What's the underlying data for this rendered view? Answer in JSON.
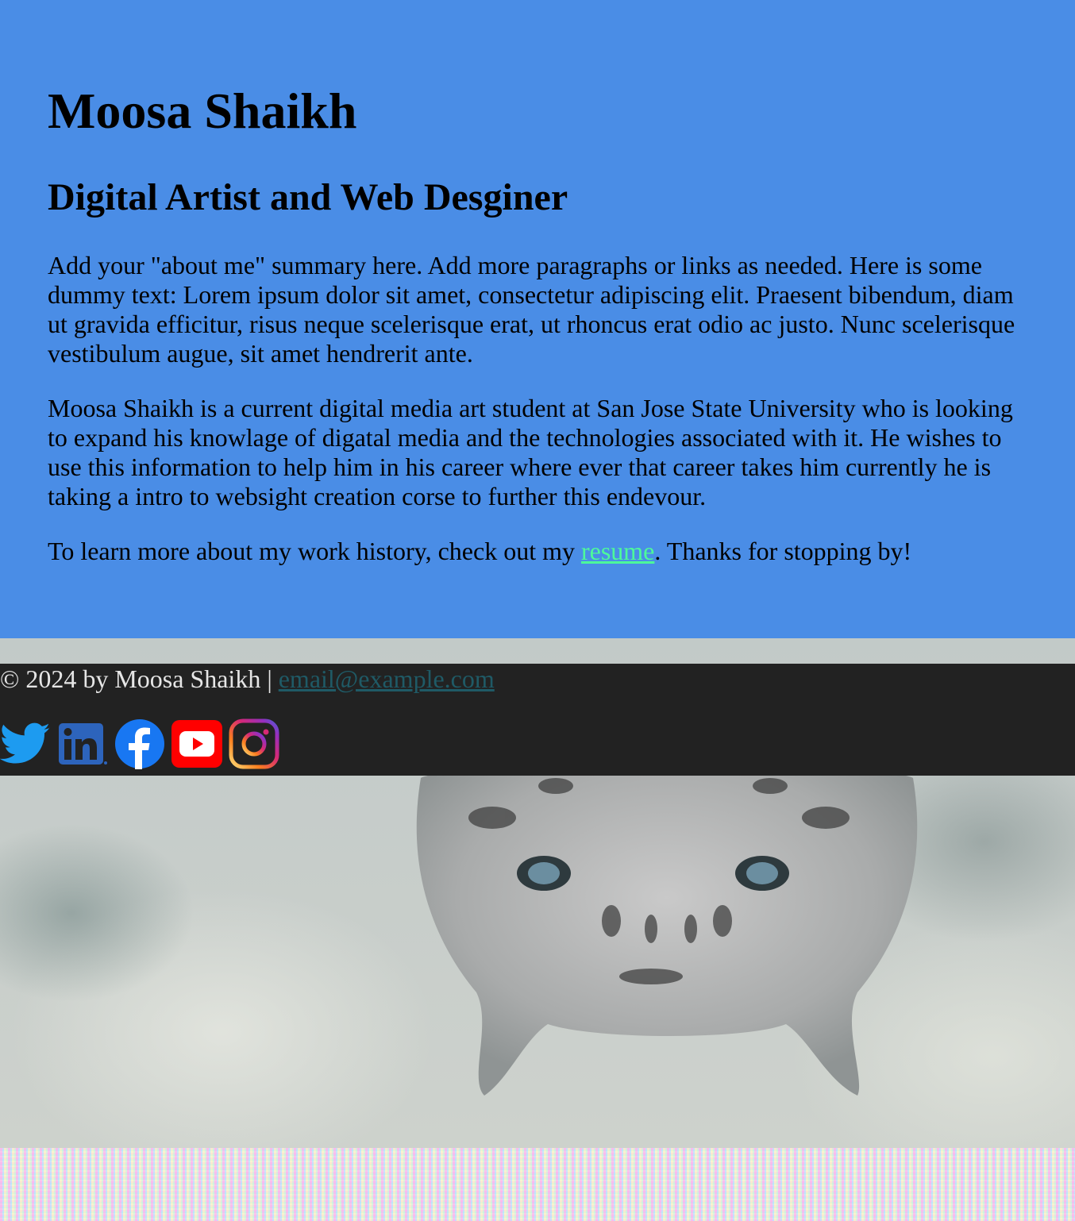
{
  "header": {
    "name": "Moosa Shaikh",
    "subtitle": "Digital Artist and Web Desginer"
  },
  "about": {
    "paragraph1": "Add your \"about me\" summary here. Add more paragraphs or links as needed. Here is some dummy text: Lorem ipsum dolor sit amet, consectetur adipiscing elit. Praesent bibendum, diam ut gravida efficitur, risus neque scelerisque erat, ut rhoncus erat odio ac justo. Nunc scelerisque vestibulum augue, sit amet hendrerit ante.",
    "paragraph2": "Moosa Shaikh is a current digital media art student at San Jose State University who is looking to expand his knowlage of digatal media and the technologies associated with it. He wishes to use this information to help him in his career where ever that career takes him currently he is taking a intro to websight creation corse to further this endevour.",
    "paragraph3_before": "To learn more about my work history, check out my ",
    "resume_link": "resume",
    "paragraph3_after": ". Thanks for stopping by!"
  },
  "footer": {
    "copyright": "© 2024 by Moosa Shaikh | ",
    "email": "email@example.com",
    "socials": [
      {
        "name": "twitter",
        "icon": "twitter-icon"
      },
      {
        "name": "linkedin",
        "icon": "linkedin-icon"
      },
      {
        "name": "facebook",
        "icon": "facebook-icon"
      },
      {
        "name": "youtube",
        "icon": "youtube-icon"
      },
      {
        "name": "instagram",
        "icon": "instagram-icon"
      }
    ]
  },
  "colors": {
    "main_bg": "#4a8de6",
    "footer_bg": "#222222",
    "resume_link": "#4dfa9a",
    "email_link": "#1f5a66"
  }
}
